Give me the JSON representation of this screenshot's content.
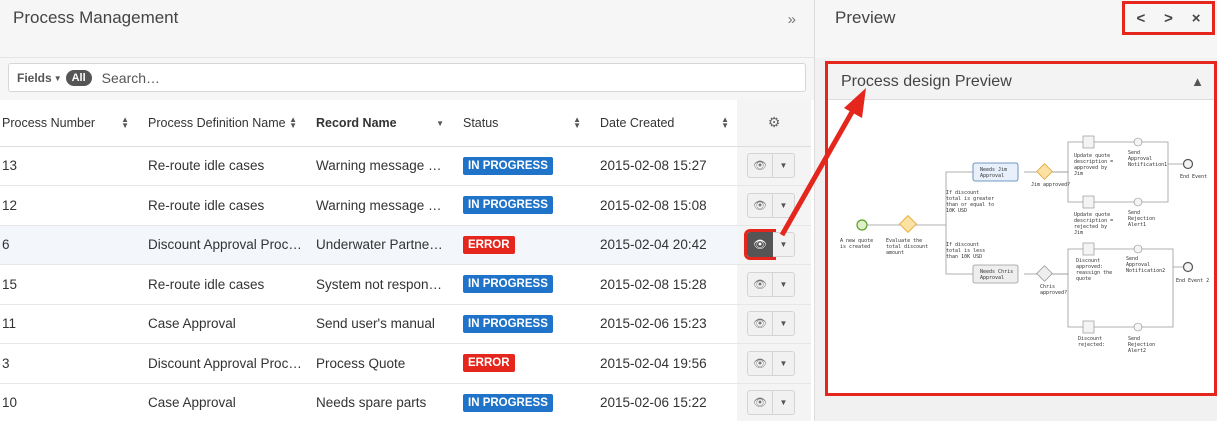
{
  "left_panel": {
    "title": "Process Management",
    "collapse_icon": "double-chevron-right",
    "collapse_glyph": "»",
    "filter": {
      "fields_label": "Fields",
      "all_label": "All",
      "search_placeholder": "Search…"
    }
  },
  "table": {
    "columns": [
      "Process Number",
      "Process Definition Name",
      "Record Name",
      "Status",
      "Date Created"
    ],
    "rows": [
      {
        "number": "13",
        "definition": "Re-route idle cases",
        "record": "Warning message …",
        "status": "IN PROGRESS",
        "status_type": "progress",
        "date": "2015-02-08 15:27"
      },
      {
        "number": "12",
        "definition": "Re-route idle cases",
        "record": "Warning message …",
        "status": "IN PROGRESS",
        "status_type": "progress",
        "date": "2015-02-08 15:08"
      },
      {
        "number": "6",
        "definition": "Discount Approval Proc…",
        "record": "Underwater Partne…",
        "status": "ERROR",
        "status_type": "error",
        "date": "2015-02-04 20:42"
      },
      {
        "number": "15",
        "definition": "Re-route idle cases",
        "record": "System not respon…",
        "status": "IN PROGRESS",
        "status_type": "progress",
        "date": "2015-02-08 15:28"
      },
      {
        "number": "11",
        "definition": "Case Approval",
        "record": "Send user's manual",
        "status": "IN PROGRESS",
        "status_type": "progress",
        "date": "2015-02-06 15:23"
      },
      {
        "number": "3",
        "definition": "Discount Approval Proc…",
        "record": "Process Quote",
        "status": "ERROR",
        "status_type": "error",
        "date": "2015-02-04 19:56"
      },
      {
        "number": "10",
        "definition": "Case Approval",
        "record": "Needs spare parts",
        "status": "IN PROGRESS",
        "status_type": "progress",
        "date": "2015-02-06 15:22"
      }
    ]
  },
  "right_panel": {
    "title": "Preview",
    "prev_glyph": "<",
    "next_glyph": ">",
    "close_glyph": "×",
    "design_title": "Process design Preview",
    "collapse_glyph": "⌃"
  },
  "diagram": {
    "labels": {
      "start": [
        "A new quote",
        "is created"
      ],
      "evaluate": [
        "Evaluate the",
        "total discount",
        "amount"
      ],
      "cond_high": [
        "If discount",
        "total is greater",
        "than or equal to",
        "10K USD"
      ],
      "cond_low": [
        "If discount",
        "total is less",
        "than 10K USD"
      ],
      "needs_jim": [
        "Needs Jim",
        "Approval"
      ],
      "needs_chris": [
        "Needs Chris",
        "Approval"
      ],
      "jim_approved": [
        "Jim approved?"
      ],
      "chris_approved": [
        "Chris",
        "approved?"
      ],
      "update_approved": [
        "Update quote",
        "description =",
        "approved by",
        "Jim"
      ],
      "update_rejected": [
        "Update quote",
        "description =",
        "rejected by",
        "Jim"
      ],
      "send_notif1": [
        "Send",
        "Approval",
        "Notification1"
      ],
      "send_reject1": [
        "Send",
        "Rejection",
        "Alert1"
      ],
      "discount_reassign": [
        "Discount",
        "approved:",
        "reassign the",
        "quote"
      ],
      "send_notif2": [
        "Send",
        "Approval",
        "Notification2"
      ],
      "discount_rejected": [
        "Discount",
        "rejected:"
      ],
      "send_reject2": [
        "Send",
        "Rejection",
        "Alert2"
      ],
      "end_event": [
        "End Event"
      ],
      "end_event2": [
        "End Event 2"
      ]
    }
  },
  "colors": {
    "progress": "#1f74c9",
    "error": "#e5261d",
    "annotation": "#e5261d"
  }
}
